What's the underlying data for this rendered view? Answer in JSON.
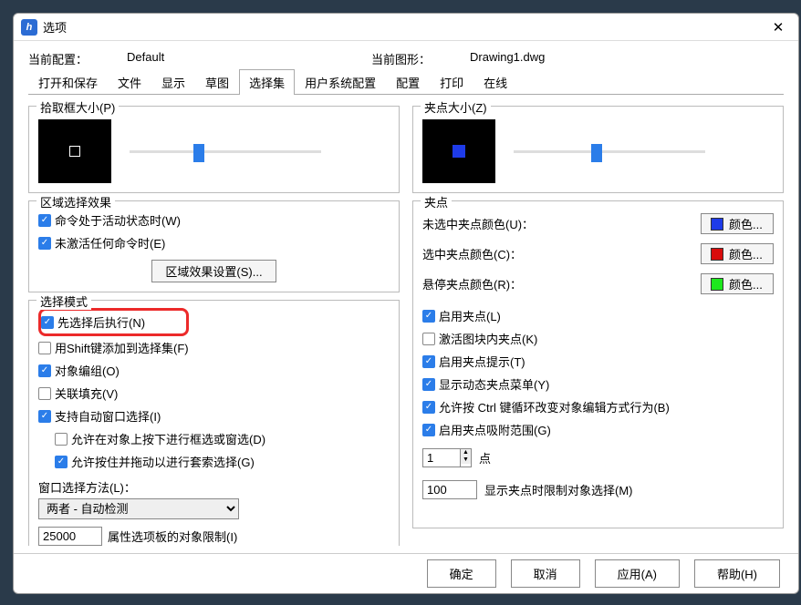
{
  "window": {
    "title": "选项",
    "close": "✕",
    "icon": "h"
  },
  "info": {
    "config_label": "当前配置：",
    "config_value": "Default",
    "drawing_label": "当前图形：",
    "drawing_value": "Drawing1.dwg"
  },
  "tabs": [
    "打开和保存",
    "文件",
    "显示",
    "草图",
    "选择集",
    "用户系统配置",
    "配置",
    "打印",
    "在线"
  ],
  "active_tab": 4,
  "left": {
    "pickbox_title": "拾取框大小(P)",
    "region_title": "区域选择效果",
    "region_cb1": "命令处于活动状态时(W)",
    "region_cb2": "未激活任何命令时(E)",
    "region_btn": "区域效果设置(S)...",
    "mode_title": "选择模式",
    "mode_cb1": "先选择后执行(N)",
    "mode_cb2": "用Shift键添加到选择集(F)",
    "mode_cb3": "对象编组(O)",
    "mode_cb4": "关联填充(V)",
    "mode_cb5": "支持自动窗口选择(I)",
    "mode_cb5a": "允许在对象上按下进行框选或窗选(D)",
    "mode_cb5b": "允许按住并拖动以进行套索选择(G)",
    "window_method_label": "窗口选择方法(L)：",
    "window_method_value": "两者 - 自动检测",
    "prop_limit_value": "25000",
    "prop_limit_label": "属性选项板的对象限制(I)"
  },
  "right": {
    "gripsize_title": "夹点大小(Z)",
    "grips_title": "夹点",
    "color1_label": "未选中夹点颜色(U)：",
    "color1_btn": "颜色...",
    "color1_hex": "#1e3be8",
    "color2_label": "选中夹点颜色(C)：",
    "color2_btn": "颜色...",
    "color2_hex": "#d80b0b",
    "color3_label": "悬停夹点颜色(R)：",
    "color3_btn": "颜色...",
    "color3_hex": "#1ee81e",
    "cb1": "启用夹点(L)",
    "cb2": "激活图块内夹点(K)",
    "cb3": "启用夹点提示(T)",
    "cb4": "显示动态夹点菜单(Y)",
    "cb5": "允许按 Ctrl 键循环改变对象编辑方式行为(B)",
    "cb6": "启用夹点吸附范围(G)",
    "spin_value": "1",
    "spin_label": "点",
    "limit_value": "100",
    "limit_label": "显示夹点时限制对象选择(M)"
  },
  "footer": {
    "ok": "确定",
    "cancel": "取消",
    "apply": "应用(A)",
    "help": "帮助(H)"
  }
}
